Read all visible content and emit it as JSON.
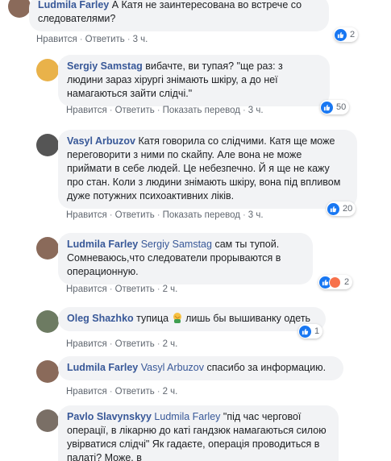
{
  "actions": {
    "like": "Нравится",
    "reply": "Ответить",
    "translate": "Показать перевод",
    "dot": "·"
  },
  "comments": [
    {
      "author": "Ludmila Farley",
      "text": "А Катя не заинтересована во встрече со следователями?",
      "time": "3 ч.",
      "reactions": "2",
      "avatar_color": "#8a6a5a"
    },
    {
      "author": "Sergiy Samstag",
      "text": "вибачте, ви тупая? \"ще раз: з людини зараз хірургі знімають шкіру, а до неї намагаються зайти слідчі.\"",
      "time": "3 ч.",
      "reactions": "50",
      "avatar_color": "#e9b24a"
    },
    {
      "author": "Vasyl Arbuzov",
      "text": "Катя говорила со слідчими. Катя ще може переговорити з ними по скайпу. Але вона не може приймати в себе людей. Це небезпечно. Й я ще не кажу про стан. Коли з людини знімають шкіру, вона під впливом дуже потужних психоактивних ліків.",
      "time": "3 ч.",
      "reactions": "20",
      "avatar_color": "#555555"
    },
    {
      "author": "Ludmila Farley",
      "mention": "Sergiy Samstag",
      "text": "сам ты тупой. Сомневаюсь,что следователи прорываются в операционную.",
      "time": "2 ч.",
      "reactions": "2",
      "avatar_color": "#8a6a5a"
    },
    {
      "author": "Oleg Shazhko",
      "text": "тупица",
      "text_after": "лишь бы вышиванку одеть",
      "emoji_icon": "facepalm-emoji-icon",
      "time": "2 ч.",
      "reactions": "1",
      "avatar_color": "#6d7b62"
    },
    {
      "author": "Ludmila Farley",
      "mention": "Vasyl Arbuzov",
      "text": "спасибо за информацию.",
      "time": "2 ч.",
      "avatar_color": "#8a6a5a"
    },
    {
      "author": "Pavlo Slavynskyy",
      "mention": "Ludmila Farley",
      "text": "\"під час чергової операції, в лікарню до каті гандзюк намагаються силою увірватися слідчі\" Як гадаєте, операція проводиться в палаті? Може, в",
      "avatar_color": "#7a6f66"
    }
  ]
}
